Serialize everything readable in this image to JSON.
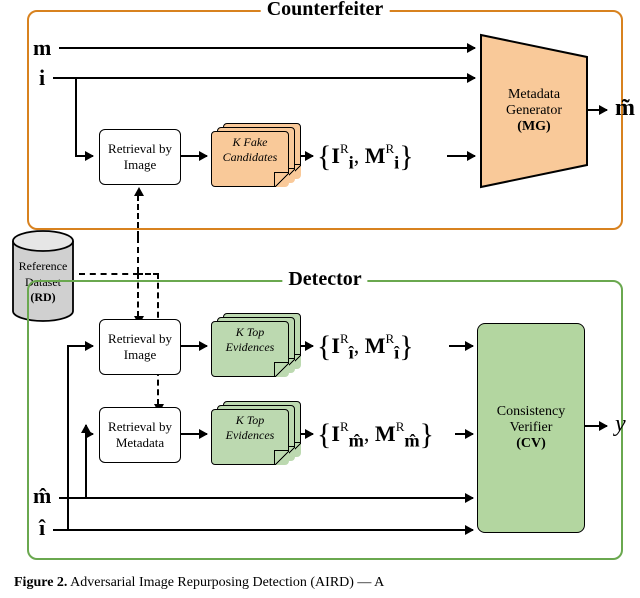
{
  "counterfeiter": {
    "title": "Counterfeiter",
    "input_m": "m",
    "input_i": "i",
    "retrieval_label": "Retrieval by Image",
    "candidates": {
      "k": "K",
      "label": "Fake Candidates"
    },
    "set": {
      "I": "I",
      "M": "M",
      "sup": "R",
      "sub": "i"
    },
    "mg": {
      "line1": "Metadata",
      "line2": "Generator",
      "bold": "(MG)"
    },
    "output": "m̃"
  },
  "rd": {
    "line1": "Reference",
    "line2": "Dataset",
    "bold": "(RD)"
  },
  "detector": {
    "title": "Detector",
    "retrieval_img": "Retrieval by Image",
    "retrieval_meta": "Retrieval by Metadata",
    "evidences": {
      "k": "K",
      "label": "Top Evidences"
    },
    "set_img": {
      "I": "I",
      "M": "M",
      "sup": "R",
      "sub": "î"
    },
    "set_meta": {
      "I": "I",
      "M": "M",
      "sup": "R",
      "sub": "m̂"
    },
    "input_m": "m̂",
    "input_i": "î",
    "cv": {
      "line1": "Consistency",
      "line2": "Verifier",
      "bold": "(CV)"
    },
    "output": "y"
  },
  "caption": {
    "fig": "Figure 2.",
    "text": " Adversarial Image Repurposing Detection (AIRD) — A"
  }
}
